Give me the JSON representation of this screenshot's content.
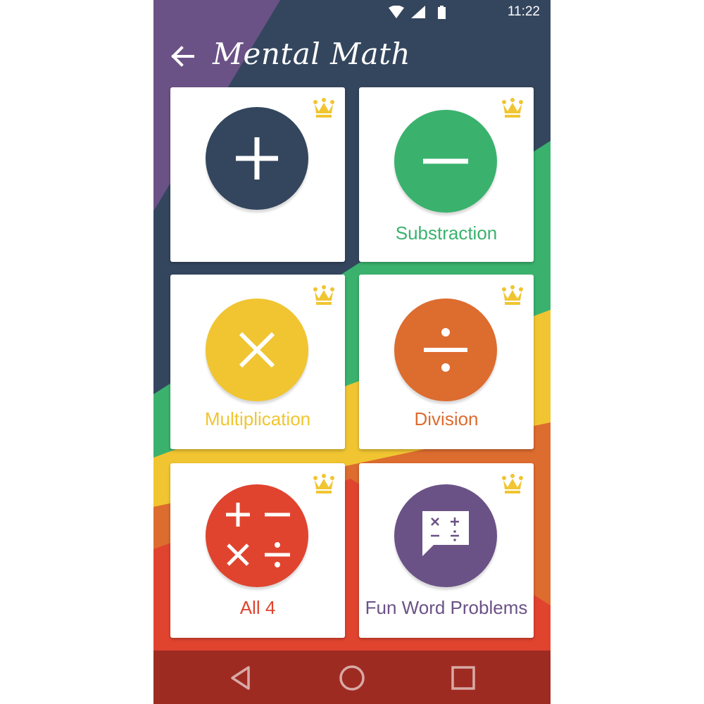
{
  "status_bar": {
    "time": "11:22",
    "icons": [
      "wifi-icon",
      "signal-icon",
      "battery-icon"
    ]
  },
  "toolbar": {
    "title": "Mental Math",
    "back_icon": "back-arrow-icon"
  },
  "colors": {
    "navy": "#34465e",
    "purple": "#6b5286",
    "green": "#3ab26e",
    "yellow": "#f0c531",
    "orange": "#dd6c2f",
    "red": "#e0442f",
    "nav_bar": "#9e2b22",
    "crown": "#f0c531"
  },
  "cards": [
    {
      "id": "addition",
      "label": "",
      "icon": "plus-icon",
      "color": "#34465e",
      "badge": "crown-icon"
    },
    {
      "id": "subtraction",
      "label": "Substraction",
      "icon": "minus-icon",
      "color": "#3ab26e",
      "badge": "crown-icon"
    },
    {
      "id": "multiplication",
      "label": "Multiplication",
      "icon": "times-icon",
      "color": "#f0c531",
      "badge": "crown-icon"
    },
    {
      "id": "division",
      "label": "Division",
      "icon": "divide-icon",
      "color": "#dd6c2f",
      "badge": "crown-icon"
    },
    {
      "id": "all-four",
      "label": "All 4",
      "icon": "all-operations-icon",
      "color": "#e0442f",
      "badge": "crown-icon"
    },
    {
      "id": "word-problems",
      "label": "Fun Word Problems",
      "icon": "speech-bubble-operations-icon",
      "color": "#6b5286",
      "badge": "crown-icon"
    }
  ],
  "nav_bar": {
    "buttons": [
      "back-triangle-icon",
      "home-circle-icon",
      "recents-square-icon"
    ]
  }
}
